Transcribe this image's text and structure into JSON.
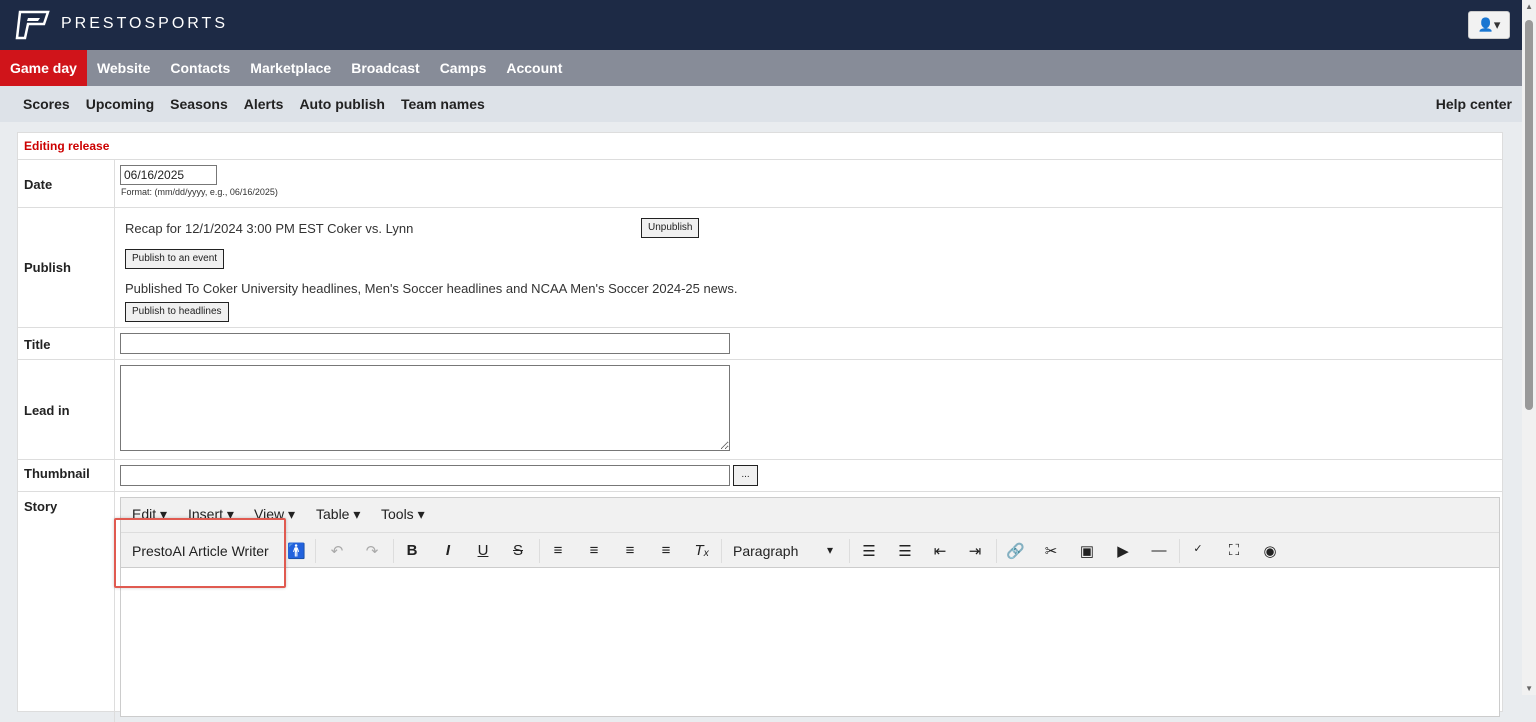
{
  "header": {
    "brand": "PRESTOSPORTS",
    "user_icon": "user-icon",
    "user_caret": "▾"
  },
  "main_nav": [
    "Game day",
    "Website",
    "Contacts",
    "Marketplace",
    "Broadcast",
    "Camps",
    "Account"
  ],
  "sub_nav": [
    "Scores",
    "Upcoming",
    "Seasons",
    "Alerts",
    "Auto publish",
    "Team names"
  ],
  "help": "Help center",
  "form": {
    "heading": "Editing release",
    "date_label": "Date",
    "date_value": "06/16/2025",
    "date_hint": "Format: (mm/dd/yyyy, e.g., 06/16/2025)",
    "publish_label": "Publish",
    "recap_text": "Recap for 12/1/2024 3:00 PM EST Coker vs. Lynn",
    "unpublish": "Unpublish",
    "publish_event": "Publish to an event",
    "published_text": "Published To Coker University headlines, Men's Soccer headlines and NCAA Men's Soccer 2024-25 news.",
    "publish_headlines": "Publish to headlines",
    "title_label": "Title",
    "leadin_label": "Lead in",
    "thumbnail_label": "Thumbnail",
    "browse": "...",
    "story_label": "Story"
  },
  "editor": {
    "menus": [
      "Edit ▾",
      "Insert ▾",
      "View ▾",
      "Table ▾",
      "Tools ▾"
    ],
    "ai_button": "PrestoAI Article Writer",
    "format": "Paragraph",
    "format_caret": "▾"
  }
}
